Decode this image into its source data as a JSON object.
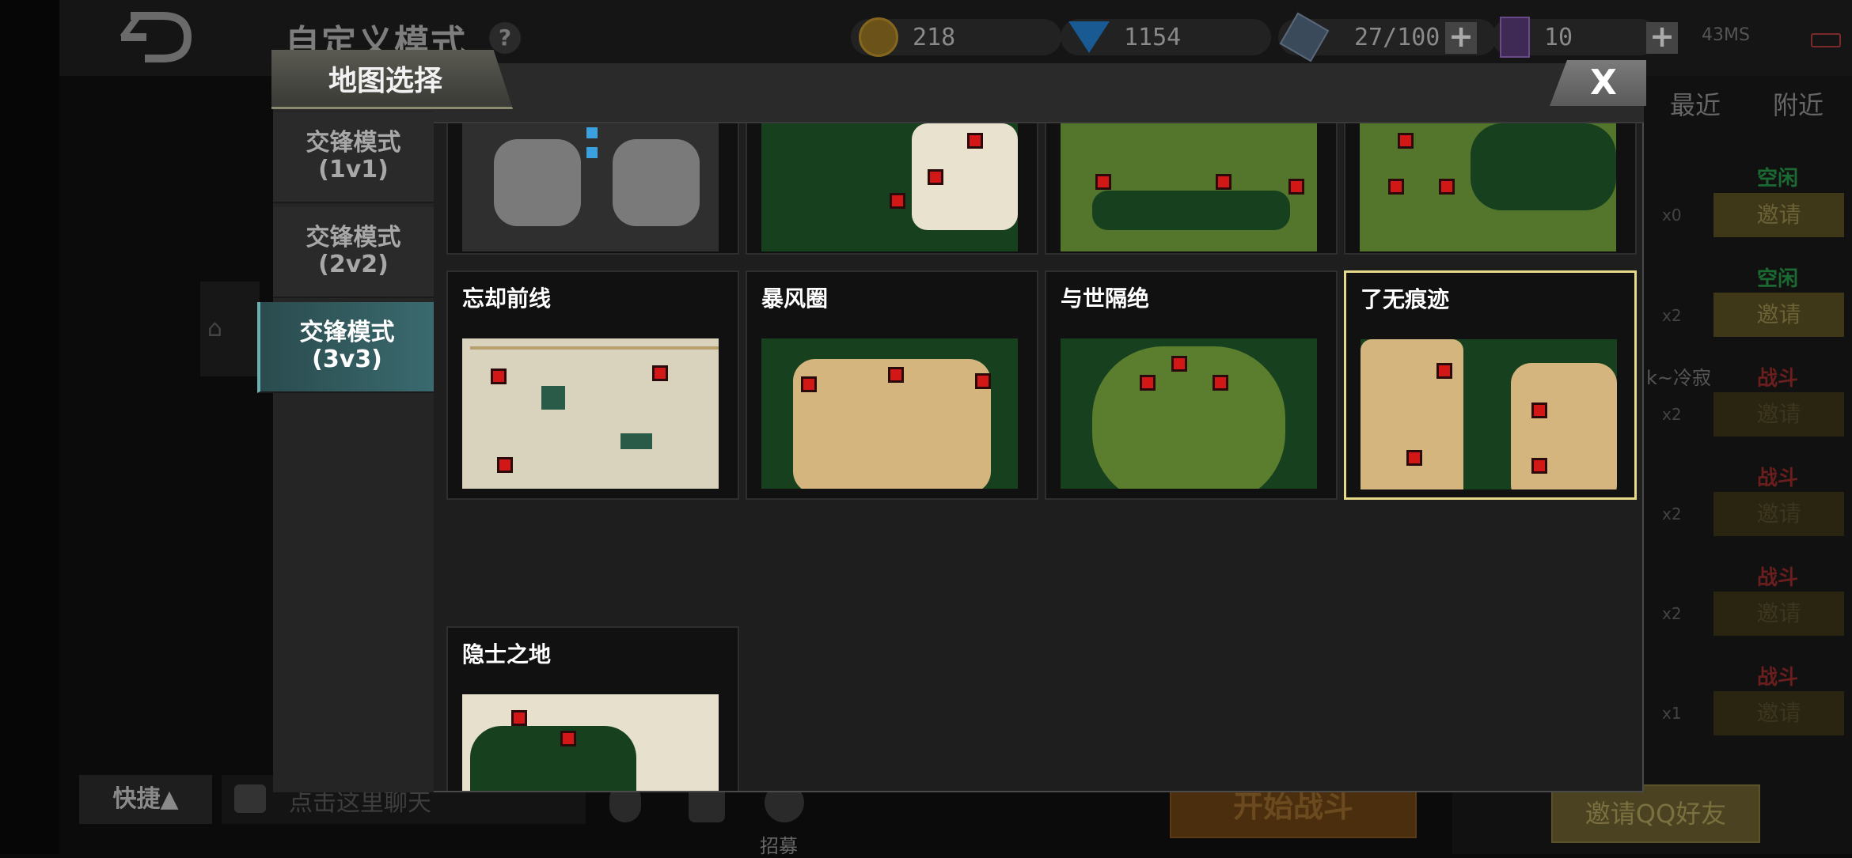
{
  "lobby": {
    "title": "自定义模式",
    "help": "?",
    "currencies": [
      {
        "icon": "gold-coin-icon",
        "value": "218"
      },
      {
        "icon": "diamond-icon",
        "value": "1154"
      },
      {
        "icon": "cube-icon",
        "value": "27/100"
      },
      {
        "icon": "card-icon",
        "value": "10"
      }
    ],
    "plus": "+",
    "ping": "43MS",
    "tabs": [
      "最近",
      "附近"
    ],
    "friends": [
      {
        "status": "空闲",
        "count": "x0",
        "invite": "邀请"
      },
      {
        "status": "空闲",
        "count": "x2",
        "invite": "邀请"
      },
      {
        "status": "战斗",
        "count": "x2",
        "invite": "邀请",
        "name": "k~冷寂"
      },
      {
        "status": "战斗",
        "count": "x2",
        "invite": "邀请"
      },
      {
        "status": "战斗",
        "count": "x2",
        "invite": "邀请"
      },
      {
        "status": "战斗",
        "count": "x1",
        "invite": "邀请"
      }
    ],
    "quick_label": "快捷▲",
    "chat_placeholder": "点击这里聊天",
    "recruit_label": "招募",
    "start_button": "开始战斗",
    "invite_qq": "邀请QQ好友"
  },
  "modal": {
    "title": "地图选择",
    "close": "X",
    "sidebar": [
      {
        "label_line1": "交锋模式",
        "label_line2": "(1v1)",
        "active": false
      },
      {
        "label_line1": "交锋模式",
        "label_line2": "(2v2)",
        "active": false
      },
      {
        "label_line1": "交锋模式",
        "label_line2": "(3v3)",
        "active": true
      }
    ],
    "maps": [
      {
        "name": "忘却前线",
        "style": "snow"
      },
      {
        "name": "暴风圈",
        "style": "desert"
      },
      {
        "name": "与世隔绝",
        "style": "grass"
      },
      {
        "name": "了无痕迹",
        "style": "desert-split",
        "selected": true
      },
      {
        "name": "隐士之地",
        "style": "snow-lake"
      }
    ]
  },
  "colors": {
    "accent": "#e7d98a",
    "active_tab": "#3a6a6e",
    "hq_marker": "#d21717",
    "water": "#17401f"
  }
}
